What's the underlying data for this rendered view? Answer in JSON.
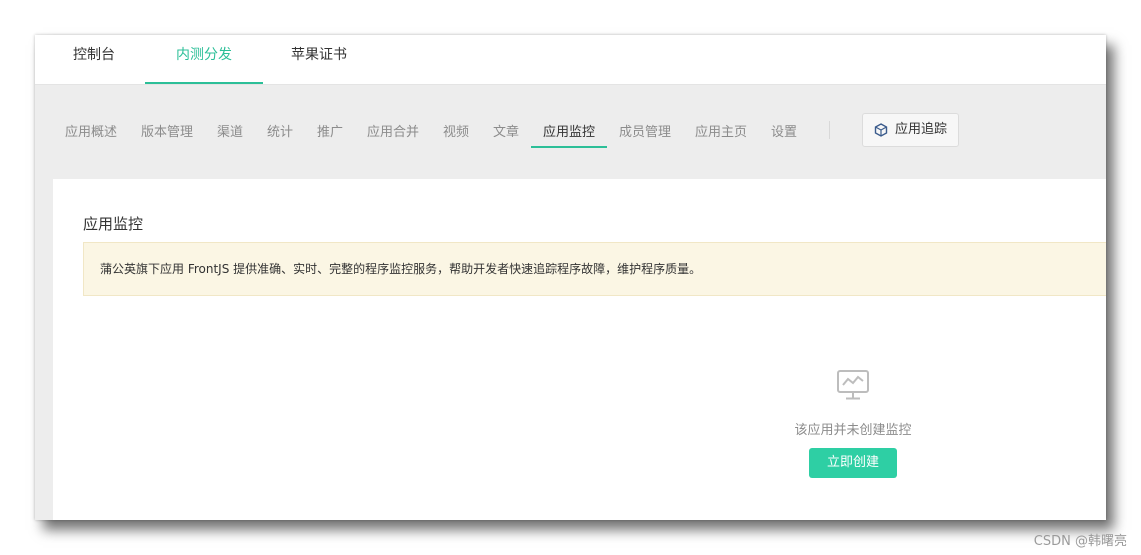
{
  "top_nav": {
    "tabs": [
      {
        "label": "控制台"
      },
      {
        "label": "内测分发",
        "active": true
      },
      {
        "label": "苹果证书"
      }
    ]
  },
  "sub_nav": {
    "items": [
      {
        "label": "应用概述"
      },
      {
        "label": "版本管理"
      },
      {
        "label": "渠道"
      },
      {
        "label": "统计"
      },
      {
        "label": "推广"
      },
      {
        "label": "应用合并"
      },
      {
        "label": "视频"
      },
      {
        "label": "文章"
      },
      {
        "label": "应用监控",
        "active": true
      },
      {
        "label": "成员管理"
      },
      {
        "label": "应用主页"
      },
      {
        "label": "设置"
      }
    ],
    "trace_button": {
      "label": "应用追踪",
      "icon": "hexagon-cube-icon"
    }
  },
  "content": {
    "title": "应用监控",
    "notice": "蒲公英旗下应用 FrontJS 提供准确、实时、完整的程序监控服务，帮助开发者快速追踪程序故障，维护程序质量。",
    "empty_state": {
      "icon": "monitor-chart-icon",
      "text": "该应用并未创建监控",
      "button_label": "立即创建"
    }
  },
  "watermark": "CSDN @韩曙亮",
  "colors": {
    "accent": "#2cbf98",
    "button": "#2ecfa4",
    "notice_bg": "#fbf6e4"
  }
}
